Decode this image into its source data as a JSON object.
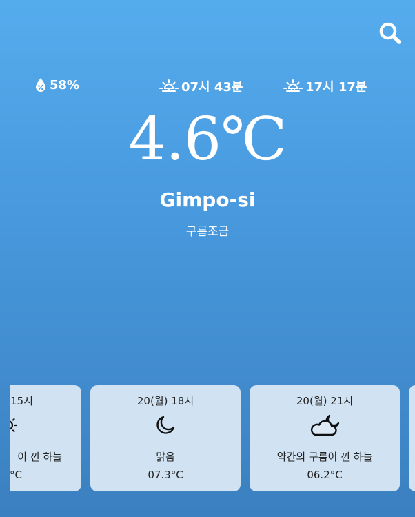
{
  "header": {
    "search_icon": "search-icon"
  },
  "stats": {
    "humidity": "58%",
    "sunrise": "07시 43분",
    "sunset": "17시 17분"
  },
  "current": {
    "temperature": "4.6℃",
    "city": "Gimpo-si",
    "description": "구름조금"
  },
  "forecast": [
    {
      "time": "15시",
      "description": "이 낀 하늘",
      "temp": "°C",
      "icon": "sun-icon"
    },
    {
      "time": "20(월) 18시",
      "description": "맑음",
      "temp": "07.3°C",
      "icon": "moon-icon"
    },
    {
      "time": "20(월) 21시",
      "description": "약간의 구름이 낀 하늘",
      "temp": "06.2°C",
      "icon": "cloud-moon-icon"
    },
    {
      "time": "",
      "description": "",
      "temp": "",
      "icon": ""
    }
  ]
}
